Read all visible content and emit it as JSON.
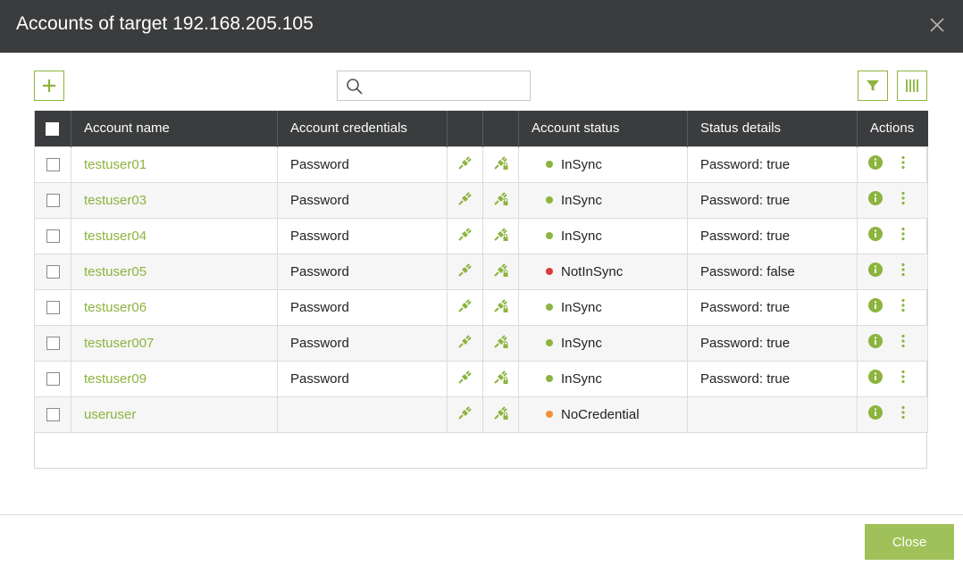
{
  "dialog": {
    "title": "Accounts of target 192.168.205.105",
    "close_label": "Close"
  },
  "search": {
    "placeholder": "",
    "value": ""
  },
  "colors": {
    "accent": "#8cb43e",
    "header_bg": "#3b3c3d",
    "insync": "#8cb43e",
    "notinsync": "#e0393e",
    "nocredential": "#f0913a"
  },
  "toolbar": {
    "add_icon": "plus-icon",
    "filter_icon": "filter-icon",
    "columns_icon": "columns-icon"
  },
  "table": {
    "columns": [
      "",
      "Account name",
      "Account credentials",
      "",
      "",
      "Account status",
      "Status details",
      "Actions"
    ],
    "rows": [
      {
        "name": "testuser01",
        "credentials": "Password",
        "status": "InSync",
        "details": "Password: true"
      },
      {
        "name": "testuser03",
        "credentials": "Password",
        "status": "InSync",
        "details": "Password: true"
      },
      {
        "name": "testuser04",
        "credentials": "Password",
        "status": "InSync",
        "details": "Password: true"
      },
      {
        "name": "testuser05",
        "credentials": "Password",
        "status": "NotInSync",
        "details": "Password: false"
      },
      {
        "name": "testuser06",
        "credentials": "Password",
        "status": "InSync",
        "details": "Password: true"
      },
      {
        "name": "testuser007",
        "credentials": "Password",
        "status": "InSync",
        "details": "Password: true"
      },
      {
        "name": "testuser09",
        "credentials": "Password",
        "status": "InSync",
        "details": "Password: true"
      },
      {
        "name": "useruser",
        "credentials": "",
        "status": "NoCredential",
        "details": ""
      }
    ]
  }
}
